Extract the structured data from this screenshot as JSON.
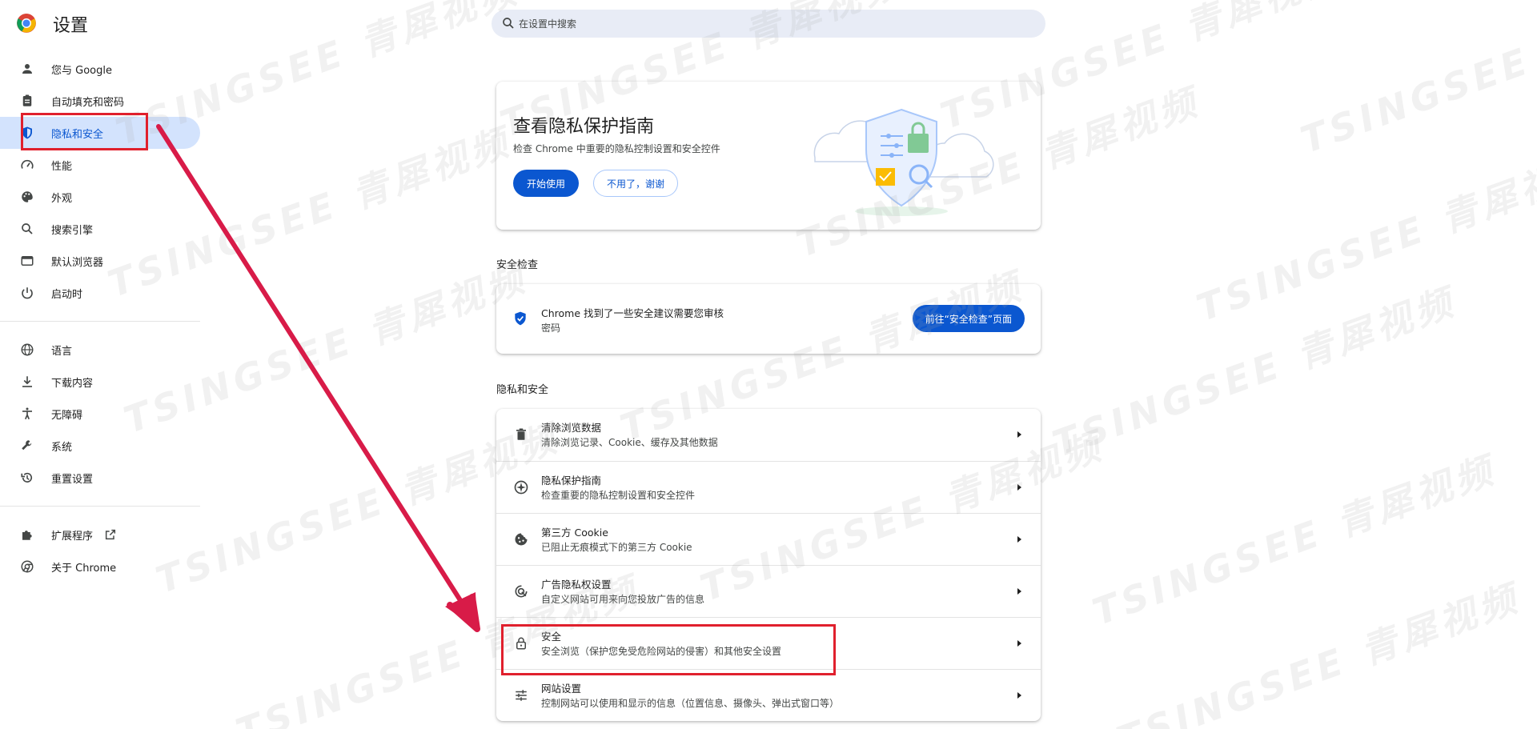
{
  "app": {
    "title": "设置"
  },
  "search": {
    "placeholder": "在设置中搜索"
  },
  "nav": {
    "group1": [
      {
        "label": "您与 Google",
        "icon": "person-icon"
      },
      {
        "label": "自动填充和密码",
        "icon": "clipboard-icon"
      },
      {
        "label": "隐私和安全",
        "icon": "shield-icon",
        "active": true
      },
      {
        "label": "性能",
        "icon": "speedometer-icon"
      },
      {
        "label": "外观",
        "icon": "palette-icon"
      },
      {
        "label": "搜索引擎",
        "icon": "search-icon"
      },
      {
        "label": "默认浏览器",
        "icon": "browser-icon"
      },
      {
        "label": "启动时",
        "icon": "power-icon"
      }
    ],
    "group2": [
      {
        "label": "语言",
        "icon": "globe-icon"
      },
      {
        "label": "下载内容",
        "icon": "download-icon"
      },
      {
        "label": "无障碍",
        "icon": "accessibility-icon"
      },
      {
        "label": "系统",
        "icon": "wrench-icon"
      },
      {
        "label": "重置设置",
        "icon": "history-icon"
      }
    ],
    "group3": [
      {
        "label": "扩展程序",
        "icon": "puzzle-icon",
        "external": true
      },
      {
        "label": "关于 Chrome",
        "icon": "chrome-icon"
      }
    ]
  },
  "guide": {
    "title": "查看隐私保护指南",
    "subtitle": "检查 Chrome 中重要的隐私控制设置和安全控件",
    "start_label": "开始使用",
    "dismiss_label": "不用了，谢谢"
  },
  "safety_check": {
    "heading": "安全检查",
    "title": "Chrome 找到了一些安全建议需要您审核",
    "subtitle": "密码",
    "button_label": "前往“安全检查”页面"
  },
  "privacy": {
    "heading": "隐私和安全",
    "rows": [
      {
        "title": "清除浏览数据",
        "subtitle": "清除浏览记录、Cookie、缓存及其他数据",
        "icon": "trash-icon"
      },
      {
        "title": "隐私保护指南",
        "subtitle": "检查重要的隐私控制设置和安全控件",
        "icon": "compass-icon"
      },
      {
        "title": "第三方 Cookie",
        "subtitle": "已阻止无痕模式下的第三方 Cookie",
        "icon": "cookie-icon"
      },
      {
        "title": "广告隐私权设置",
        "subtitle": "自定义网站可用来向您投放广告的信息",
        "icon": "ads-icon"
      },
      {
        "title": "安全",
        "subtitle": "安全浏览（保护您免受危险网站的侵害）和其他安全设置",
        "icon": "lock-icon"
      },
      {
        "title": "网站设置",
        "subtitle": "控制网站可以使用和显示的信息（位置信息、摄像头、弹出式窗口等）",
        "icon": "sliders-icon"
      }
    ]
  },
  "colors": {
    "accent": "#0b57d0",
    "active_bg": "#d3e3fd",
    "annotation": "#e0202d",
    "arrow": "#d81b48"
  },
  "watermark": {
    "text": "TSINGSEE 青犀视频"
  }
}
